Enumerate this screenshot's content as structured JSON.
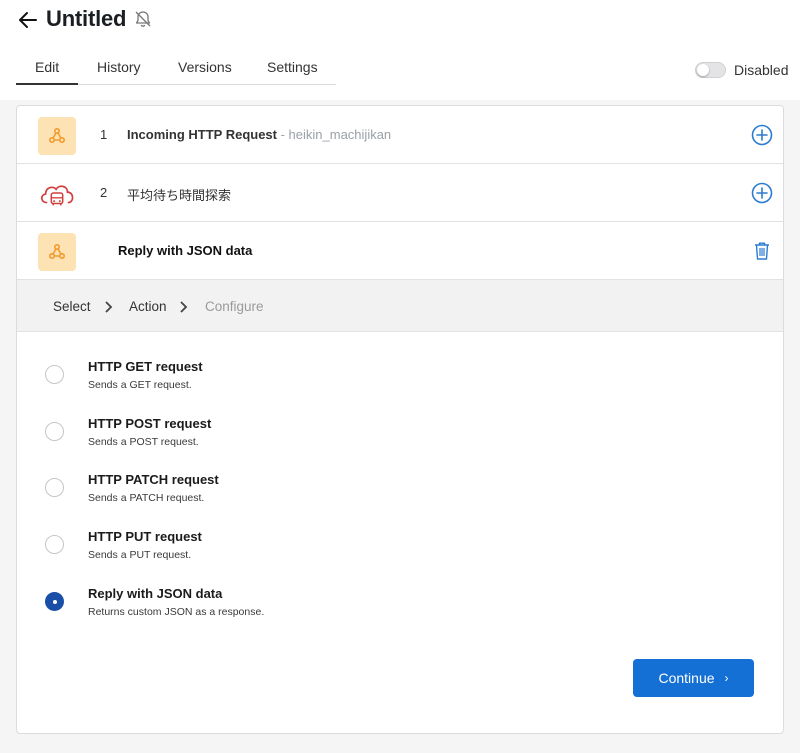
{
  "header": {
    "title": "Untitled",
    "tabs": [
      {
        "label": "Edit"
      },
      {
        "label": "History"
      },
      {
        "label": "Versions"
      },
      {
        "label": "Settings"
      }
    ],
    "toggle_label": "Disabled"
  },
  "steps": [
    {
      "number": "1",
      "title": "Incoming HTTP Request",
      "subtitle": " - heikin_machijikan",
      "icon": "webhook-icon"
    },
    {
      "number": "2",
      "title": "平均待ち時間探索",
      "icon": "cloud-bus-icon"
    },
    {
      "title": "Reply with JSON data",
      "icon": "webhook-icon"
    }
  ],
  "breadcrumbs": [
    "Select",
    "Action",
    "Configure"
  ],
  "options": [
    {
      "title": "HTTP GET request",
      "desc": "Sends a GET request.",
      "checked": false
    },
    {
      "title": "HTTP POST request",
      "desc": "Sends a POST request.",
      "checked": false
    },
    {
      "title": "HTTP PATCH request",
      "desc": "Sends a PATCH request.",
      "checked": false
    },
    {
      "title": "HTTP PUT request",
      "desc": "Sends a PUT request.",
      "checked": false
    },
    {
      "title": "Reply with JSON data",
      "desc": "Returns custom JSON as a response.",
      "checked": true
    }
  ],
  "continue_label": "Continue",
  "colors": {
    "primary": "#1570d6",
    "radio_checked": "#1a4fa8",
    "plus_icon": "#2b7bd1",
    "webhook_bg": "#fde2b4",
    "cloud_icon": "#d23f3f"
  }
}
